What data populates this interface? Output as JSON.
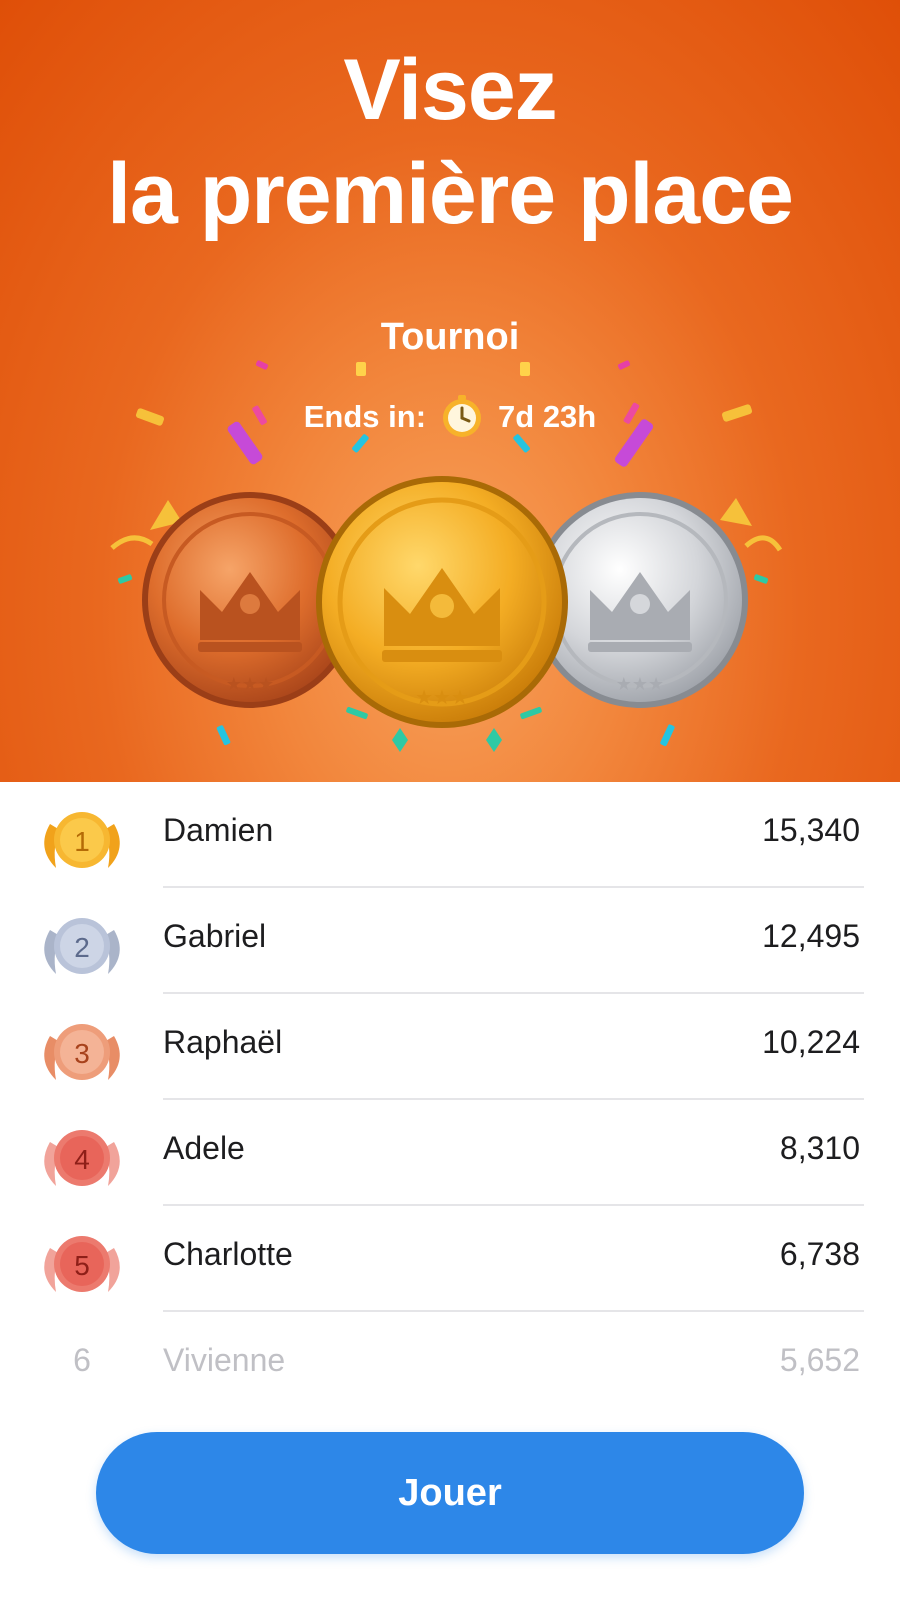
{
  "hero": {
    "headline_line1": "Visez",
    "headline_line2": "la première place",
    "tournament_label": "Tournoi",
    "ends_label": "Ends in:",
    "ends_time": "7d 23h",
    "clock_icon": "alarm-clock-icon",
    "medals": [
      "bronze-crown-medal",
      "gold-crown-medal",
      "silver-crown-medal"
    ]
  },
  "leaderboard": {
    "rows": [
      {
        "rank": "1",
        "name": "Damien",
        "score": "15,340",
        "badge_color": "#f7b731"
      },
      {
        "rank": "2",
        "name": "Gabriel",
        "score": "12,495",
        "badge_color": "#b9c3d9"
      },
      {
        "rank": "3",
        "name": "Raphaël",
        "score": "10,224",
        "badge_color": "#ee9d7a"
      },
      {
        "rank": "4",
        "name": "Adele",
        "score": "8,310",
        "badge_color": "#ec7a6e"
      },
      {
        "rank": "5",
        "name": "Charlotte",
        "score": "6,738",
        "badge_color": "#ec7a6e"
      },
      {
        "rank": "6",
        "name": "Vivienne",
        "score": "5,652"
      }
    ]
  },
  "play_button": {
    "label": "Jouer"
  },
  "colors": {
    "hero_orange": "#e45a12",
    "button_blue": "#2d87e8"
  }
}
